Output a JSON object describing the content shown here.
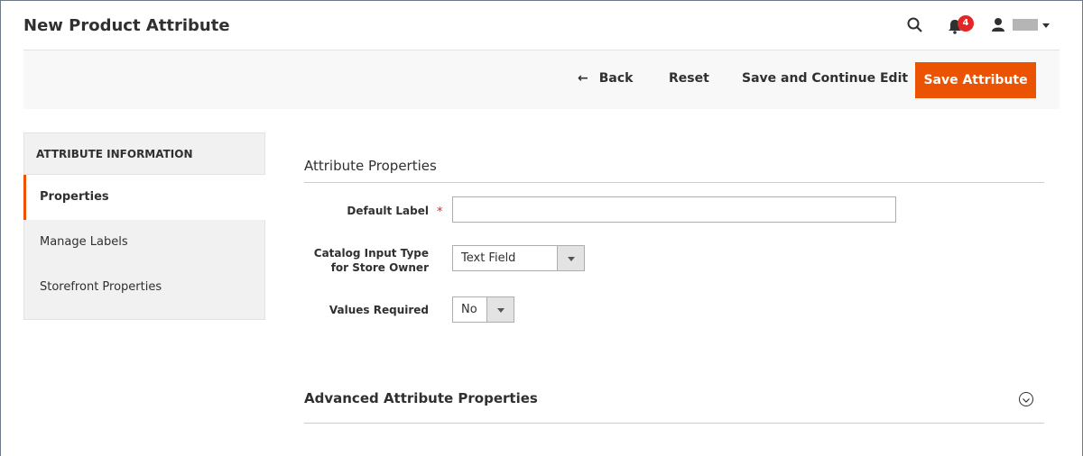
{
  "header": {
    "title": "New Product Attribute",
    "notification_count": "4"
  },
  "actions": {
    "back": "Back",
    "reset": "Reset",
    "save_continue": "Save and Continue Edit",
    "save": "Save Attribute"
  },
  "sidebar": {
    "heading": "ATTRIBUTE INFORMATION",
    "items": [
      {
        "label": "Properties"
      },
      {
        "label": "Manage Labels"
      },
      {
        "label": "Storefront Properties"
      }
    ]
  },
  "form": {
    "section_title": "Attribute Properties",
    "default_label": {
      "label": "Default Label",
      "value": ""
    },
    "input_type": {
      "label_line1": "Catalog Input Type",
      "label_line2": "for Store Owner",
      "value": "Text Field"
    },
    "values_required": {
      "label": "Values Required",
      "value": "No"
    },
    "advanced_title": "Advanced Attribute Properties"
  },
  "colors": {
    "accent": "#eb5202",
    "badge": "#e22626"
  }
}
